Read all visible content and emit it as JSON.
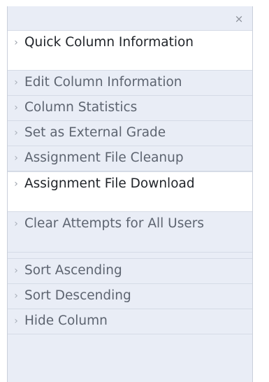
{
  "menu": {
    "close_glyph": "×",
    "chevron_glyph": "›",
    "items": [
      {
        "label": "Quick Column Information",
        "highlighted": true
      },
      {
        "label": "Edit Column Information",
        "highlighted": false
      },
      {
        "label": "Column Statistics",
        "highlighted": false
      },
      {
        "label": "Set as External Grade",
        "highlighted": false
      },
      {
        "label": "Assignment File Cleanup",
        "highlighted": false
      },
      {
        "label": "Assignment File Download",
        "highlighted": true
      },
      {
        "label": "Clear Attempts for All Users",
        "highlighted": false
      },
      {
        "label": "Sort Ascending",
        "highlighted": false
      },
      {
        "label": "Sort Descending",
        "highlighted": false
      },
      {
        "label": "Hide Column",
        "highlighted": false
      }
    ]
  },
  "colors": {
    "menu_background": "#e9edf6",
    "highlight_background": "#ffffff",
    "text": "#5d6470",
    "highlight_text": "#1f2328"
  }
}
